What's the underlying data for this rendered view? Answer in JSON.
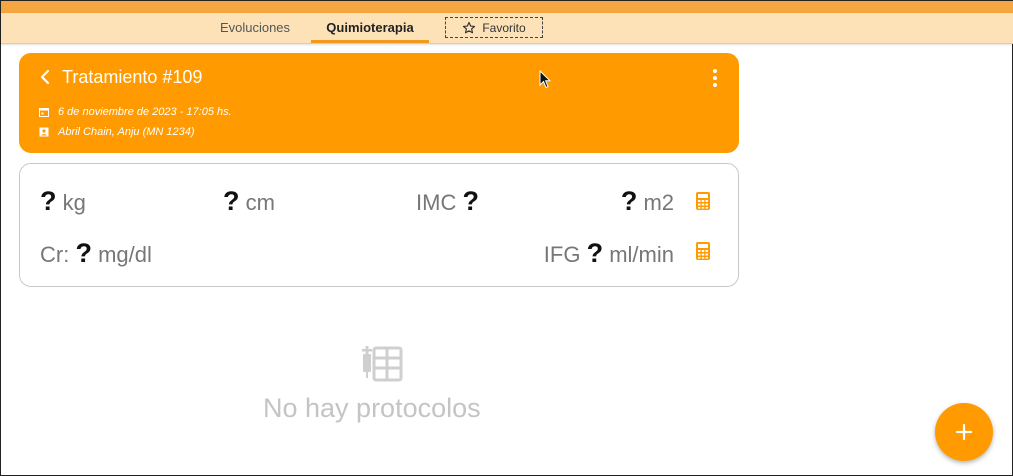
{
  "tabs": [
    {
      "label": "Evoluciones"
    },
    {
      "label": "Quimioterapia",
      "active": true
    }
  ],
  "favorite": {
    "label": "Favorito",
    "icon": "star-outline-icon"
  },
  "treatment": {
    "title": "Tratamiento #109",
    "date": "6 de noviembre de 2023 - 17:05 hs.",
    "doctor": "Abril Chain, Anju (MN 1234)"
  },
  "stats": {
    "weight": {
      "value": "?",
      "unit": "kg"
    },
    "height": {
      "value": "?",
      "unit": "cm"
    },
    "imc": {
      "label": "IMC",
      "value": "?"
    },
    "bsa": {
      "value": "?",
      "unit": "m2"
    },
    "creatinine": {
      "label": "Cr:",
      "value": "?",
      "unit": "mg/dl"
    },
    "ifg": {
      "label": "IFG",
      "value": "?",
      "unit": "ml/min"
    }
  },
  "empty_state": {
    "text": "No hay protocolos",
    "icon": "protocol-table-icon"
  },
  "colors": {
    "accent": "#ff9a00",
    "tabbar": "#fde2b8",
    "top_strip": "#f6a640"
  }
}
